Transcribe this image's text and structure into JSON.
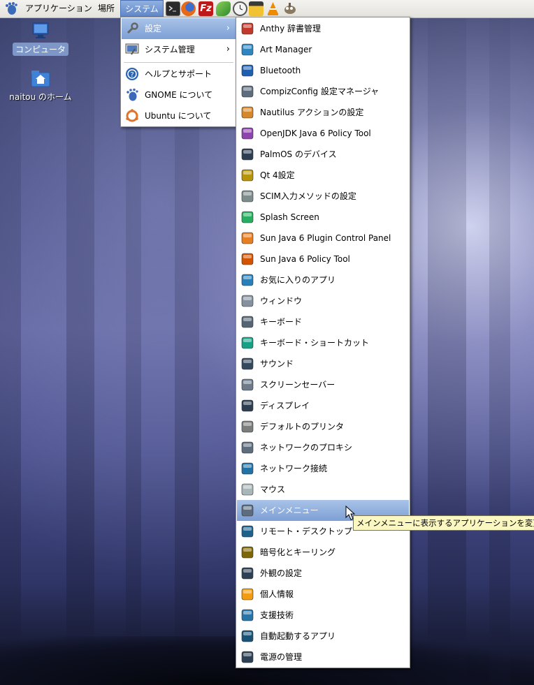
{
  "panel": {
    "applications": "アプリケーション",
    "places": "場所",
    "system": "システム"
  },
  "desktop": {
    "computer": "コンピュータ",
    "home": "naitou のホーム"
  },
  "system_menu": [
    {
      "label": "設定",
      "icon": "wrench-icon",
      "submenu": true,
      "highlighted": true
    },
    {
      "label": "システム管理",
      "icon": "system-admin-icon",
      "submenu": true
    },
    {
      "label": "ヘルプとサポート",
      "icon": "help-icon"
    },
    {
      "label": "GNOME について",
      "icon": "gnome-foot-icon"
    },
    {
      "label": "Ubuntu について",
      "icon": "ubuntu-icon"
    }
  ],
  "settings_menu": [
    {
      "label": "Anthy 辞書管理",
      "icon": "anthy-dictionary-icon"
    },
    {
      "label": "Art Manager",
      "icon": "art-manager-icon"
    },
    {
      "label": "Bluetooth",
      "icon": "bluetooth-icon"
    },
    {
      "label": "CompizConfig 設定マネージャ",
      "icon": "compizconfig-icon"
    },
    {
      "label": "Nautilus アクションの設定",
      "icon": "nautilus-actions-icon"
    },
    {
      "label": "OpenJDK Java 6 Policy Tool",
      "icon": "openjdk-policy-icon"
    },
    {
      "label": "PalmOS のデバイス",
      "icon": "palm-device-icon"
    },
    {
      "label": "Qt 4設定",
      "icon": "qt-settings-icon"
    },
    {
      "label": "SCIM入力メソッドの設定",
      "icon": "scim-icon"
    },
    {
      "label": "Splash Screen",
      "icon": "splash-screen-icon"
    },
    {
      "label": "Sun Java 6 Plugin Control Panel",
      "icon": "java-plugin-icon"
    },
    {
      "label": "Sun Java 6 Policy Tool",
      "icon": "java-policy-icon"
    },
    {
      "label": "お気に入りのアプリ",
      "icon": "preferred-apps-icon"
    },
    {
      "label": "ウィンドウ",
      "icon": "window-icon"
    },
    {
      "label": "キーボード",
      "icon": "keyboard-icon"
    },
    {
      "label": "キーボード・ショートカット",
      "icon": "keyboard-shortcuts-icon"
    },
    {
      "label": "サウンド",
      "icon": "sound-icon"
    },
    {
      "label": "スクリーンセーバー",
      "icon": "screensaver-icon"
    },
    {
      "label": "ディスプレイ",
      "icon": "display-icon"
    },
    {
      "label": "デフォルトのプリンタ",
      "icon": "printer-icon"
    },
    {
      "label": "ネットワークのプロキシ",
      "icon": "network-proxy-icon"
    },
    {
      "label": "ネットワーク接続",
      "icon": "network-connections-icon"
    },
    {
      "label": "マウス",
      "icon": "mouse-icon"
    },
    {
      "label": "メインメニュー",
      "icon": "main-menu-icon",
      "highlighted": true
    },
    {
      "label": "リモート・デスクトップ",
      "icon": "remote-desktop-icon"
    },
    {
      "label": "暗号化とキーリング",
      "icon": "encryption-icon"
    },
    {
      "label": "外観の設定",
      "icon": "appearance-icon"
    },
    {
      "label": "個人情報",
      "icon": "personal-info-icon"
    },
    {
      "label": "支援技術",
      "icon": "accessibility-icon"
    },
    {
      "label": "自動起動するアプリ",
      "icon": "startup-apps-icon"
    },
    {
      "label": "電源の管理",
      "icon": "power-management-icon"
    }
  ],
  "tooltip": "メインメニューに表示するアプリケーションを変更",
  "colors": {
    "highlight": "#7d9fd4",
    "tooltip_bg": "#fbf7c0",
    "panel_bg": "#ebe9e4"
  }
}
